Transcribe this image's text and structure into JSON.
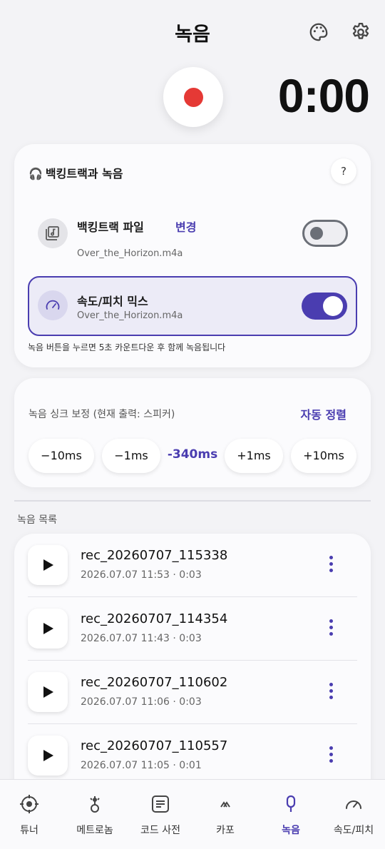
{
  "header": {
    "title": "녹음",
    "icons": [
      "palette-icon",
      "gear-icon"
    ]
  },
  "recorder": {
    "timer": "0:00",
    "record_color": "#e53935"
  },
  "backing": {
    "title": "백킹트랙과 녹음",
    "help": "?",
    "file_label": "백킹트랙 파일",
    "change_label": "변경",
    "file_name": "Over_the_Horizon.m4a",
    "file_toggle_on": false,
    "mix_label": "속도/피치 믹스",
    "mix_file_name": "Over_the_Horizon.m4a",
    "mix_toggle_on": true,
    "note": "녹음 버튼을 누르면 5초 카운트다운 후 함께 녹음됩니다"
  },
  "sync": {
    "label": "녹음 싱크 보정 (현재 출력: 스피커)",
    "auto_label": "자동 정렬",
    "buttons": [
      "−10ms",
      "−1ms",
      "+1ms",
      "+10ms"
    ],
    "offset": "-340ms"
  },
  "list": {
    "heading": "녹음 목록",
    "items": [
      {
        "name": "rec_20260707_115338",
        "meta": "2026.07.07 11:53  ·  0:03"
      },
      {
        "name": "rec_20260707_114354",
        "meta": "2026.07.07 11:43  ·  0:03"
      },
      {
        "name": "rec_20260707_110602",
        "meta": "2026.07.07 11:06  ·  0:03"
      },
      {
        "name": "rec_20260707_110557",
        "meta": "2026.07.07 11:05  ·  0:01"
      }
    ]
  },
  "nav": {
    "items": [
      {
        "label": "튜너",
        "icon": "tuner-icon",
        "active": false
      },
      {
        "label": "메트로놈",
        "icon": "metronome-icon",
        "active": false
      },
      {
        "label": "코드 사전",
        "icon": "chord-book-icon",
        "active": false
      },
      {
        "label": "카포",
        "icon": "capo-icon",
        "active": false
      },
      {
        "label": "녹음",
        "icon": "mic-icon",
        "active": true
      },
      {
        "label": "속도/피치",
        "icon": "speedometer-icon",
        "active": false
      }
    ]
  },
  "colors": {
    "accent": "#4a3db0",
    "background": "#f3f3f6"
  }
}
